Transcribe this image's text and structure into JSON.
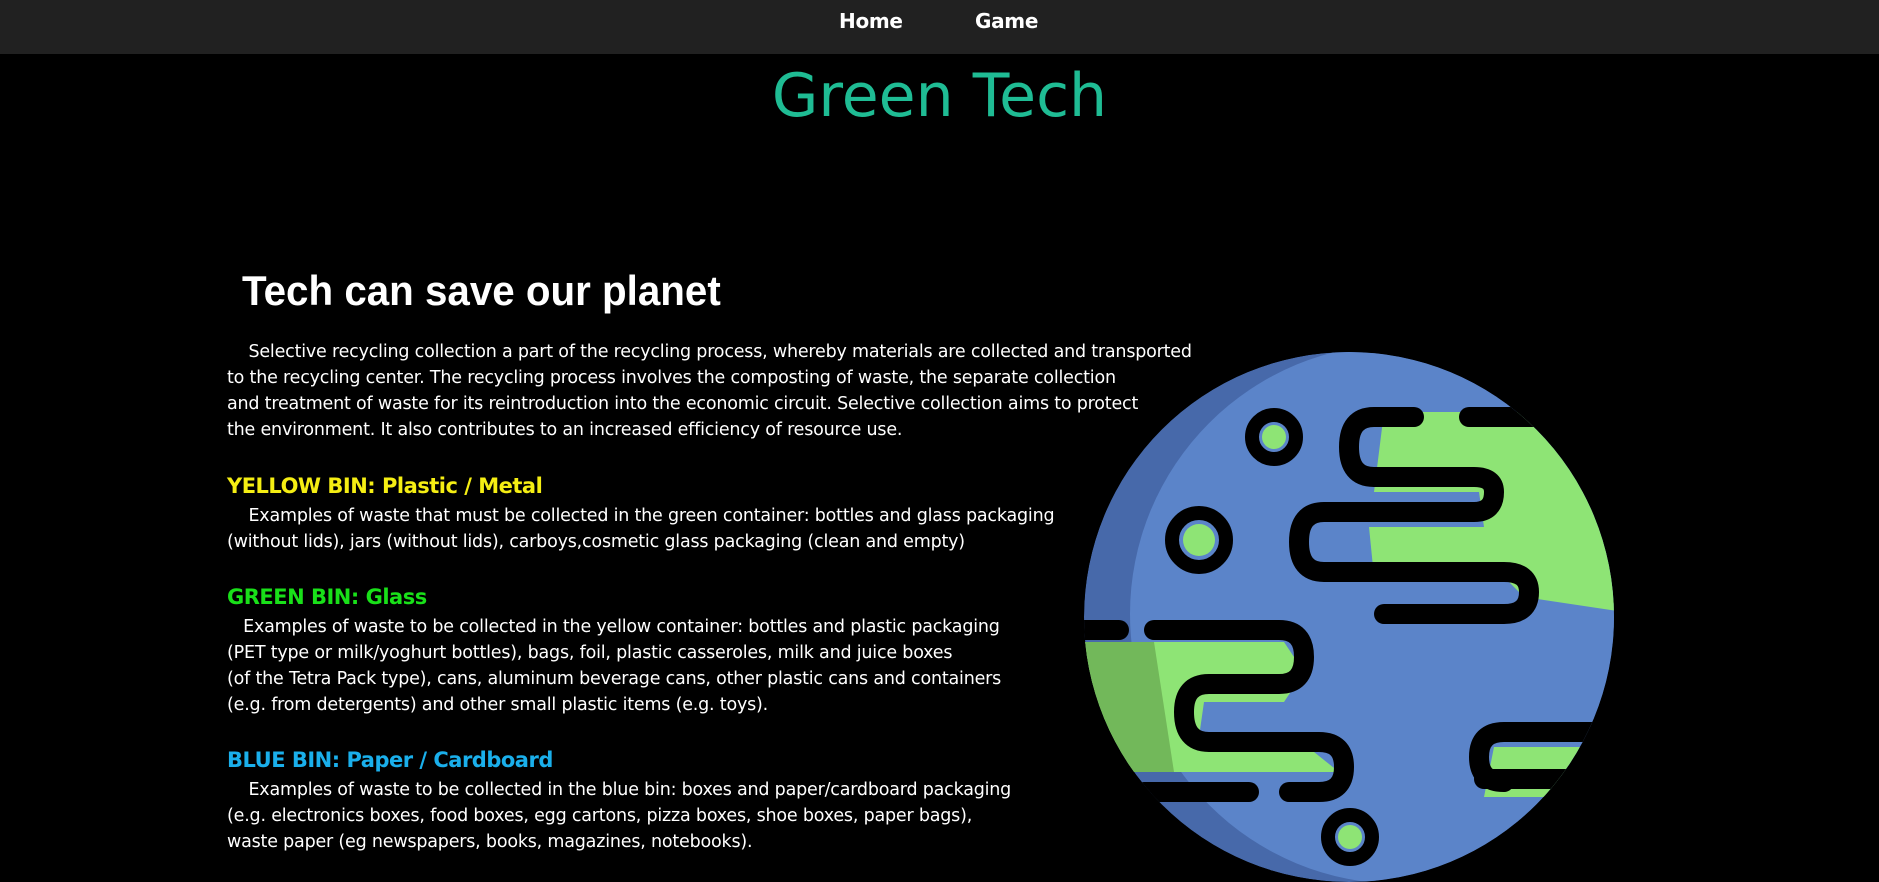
{
  "nav": {
    "home_label": "Home",
    "game_label": "Game"
  },
  "site": {
    "title": "Green Tech"
  },
  "main": {
    "heading": "Tech can save our planet",
    "intro": "    Selective recycling collection a part of the recycling process, whereby materials are collected and transported\nto the recycling center. The recycling process involves the composting of waste, the separate collection\nand treatment of waste for its reintroduction into the economic circuit. Selective collection aims to protect\nthe environment. It also contributes to an increased efficiency of resource use."
  },
  "bins": {
    "yellow": {
      "heading": "YELLOW BIN: Plastic / Metal",
      "text": "    Examples of waste that must be collected in the green container: bottles and glass packaging\n(without lids), jars (without lids), carboys,cosmetic glass packaging (clean and empty)"
    },
    "green": {
      "heading": "GREEN BIN: Glass",
      "text": "   Examples of waste to be collected in the yellow container: bottles and plastic packaging\n(PET type or milk/yoghurt bottles), bags, foil, plastic casseroles, milk and juice boxes\n(of the Tetra Pack type), cans, aluminum beverage cans, other plastic cans and containers\n(e.g. from detergents) and other small plastic items (e.g. toys)."
    },
    "blue": {
      "heading": "BLUE BIN: Paper / Cardboard",
      "text": "    Examples of waste to be collected in the blue bin: boxes and paper/cardboard packaging\n(e.g. electronics boxes, food boxes, egg cartons, pizza boxes, shoe boxes, paper bags),\nwaste paper (eg newspapers, books, magazines, notebooks)."
    }
  },
  "colors": {
    "nav_bg": "#212121",
    "title": "#1fbc94",
    "yellow": "#f5ee13",
    "green": "#19e019",
    "blue": "#1aafeb",
    "planet_ocean": "#5b84c9",
    "planet_land": "#8ee475"
  },
  "illustration": {
    "icon": "planet-earth-icon"
  }
}
